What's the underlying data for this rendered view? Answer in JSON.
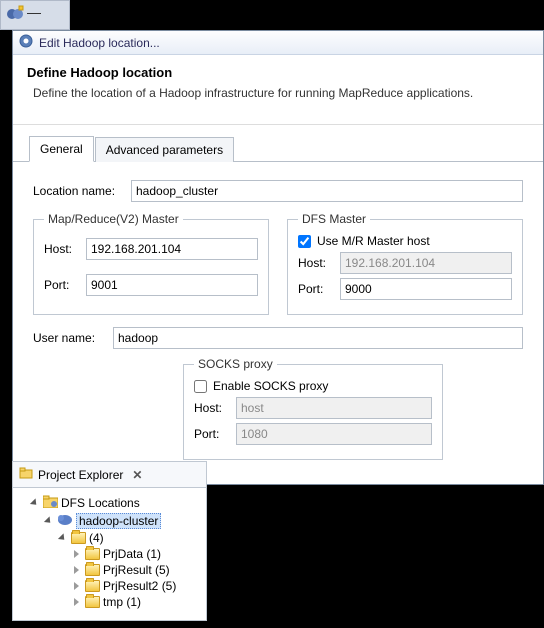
{
  "dialog": {
    "title": "Edit Hadoop location...",
    "heading": "Define Hadoop location",
    "subheading": "Define the location of a Hadoop infrastructure for running MapReduce applications."
  },
  "tabs": {
    "general": "General",
    "advanced": "Advanced parameters"
  },
  "general": {
    "location_name_label": "Location name:",
    "location_name": "hadoop_cluster",
    "mr_legend": "Map/Reduce(V2) Master",
    "dfs_legend": "DFS Master",
    "host_label": "Host:",
    "port_label": "Port:",
    "mr_host": "192.168.201.104",
    "mr_port": "9001",
    "use_mr_label": "Use M/R Master host",
    "dfs_host": "192.168.201.104",
    "dfs_port": "9000",
    "user_name_label": "User name:",
    "user_name": "hadoop",
    "socks_legend": "SOCKS proxy",
    "socks_enable_label": "Enable SOCKS proxy",
    "socks_host": "host",
    "socks_port": "1080"
  },
  "explorer": {
    "title": "Project Explorer",
    "root": "DFS Locations",
    "cluster": "hadoop-cluster",
    "count_node": "(4)",
    "children": [
      "PrjData (1)",
      "PrjResult (5)",
      "PrjResult2 (5)",
      "tmp (1)"
    ]
  }
}
